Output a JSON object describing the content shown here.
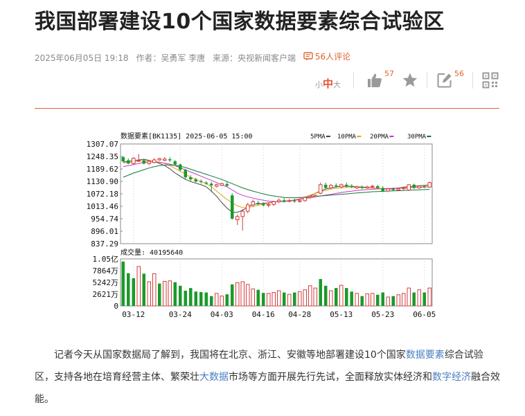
{
  "article": {
    "title": "我国部署建设10个国家数据要素综合试验区",
    "meta": {
      "datetime": "2025年06月05日 19:18",
      "author": "作者：吴勇军 李唐",
      "source": "来源：央视新闻客户端",
      "comments": "56人评论"
    },
    "body": {
      "p1": "记者今天从国家数据局了解到，我国将在北京、浙江、安徽等地部署建设10个国家",
      "link1": "数据要素",
      "p2": "综合试验区，支持各地在培育经营主体、繁荣壮",
      "link2": "大数据",
      "p3": "市场等方面开展先行先试，全面释放实体经济和",
      "link3": "数字经济",
      "p4": "融合效能。"
    }
  },
  "toolbar": {
    "font_small": "小",
    "font_mid": "中",
    "font_large": "大",
    "like_count": "57",
    "comment_count": "56",
    "icons": [
      "like-icon",
      "favorite-star-icon",
      "edit-comment-icon",
      "qrcode-icon"
    ],
    "accent_color": "#e0642d"
  },
  "chart_data": {
    "type": "candlestick",
    "header": {
      "name": "数据要素[BK1135] 2025-06-05 15:00",
      "ma_labels": [
        "5PMA-",
        "10PMA-",
        "20PMA-",
        "30PMA-"
      ],
      "ma_colors": [
        "#aaaaaa",
        "#444444",
        "#e8a317",
        "#cc33cc",
        "#117733"
      ]
    },
    "price_ticks": [
      "1307.07",
      "1248.35",
      "1189.62",
      "1130.90",
      "1072.18",
      "1013.46",
      "954.74",
      "896.01",
      "837.29"
    ],
    "price_range": [
      837.29,
      1307.07
    ],
    "volume_header": "成交量: 40195640",
    "volume_ticks": [
      "1.05亿",
      "7864万",
      "5242万",
      "2621万",
      "0"
    ],
    "volume_range": [
      0,
      105000000
    ],
    "date_ticks": [
      "03-12",
      "03-24",
      "04-03",
      "04-16",
      "04-28",
      "05-13",
      "05-23",
      "06-05"
    ],
    "date_tick_index": [
      2,
      11,
      19,
      27,
      34,
      42,
      50,
      58
    ],
    "up_color": "#d43c3c",
    "down_color": "#1a9a2a",
    "candles": [
      [
        1245,
        1250,
        1225,
        1222,
        "down"
      ],
      [
        1230,
        1240,
        1215,
        1212,
        "down"
      ],
      [
        1215,
        1245,
        1240,
        1210,
        "up"
      ],
      [
        1228,
        1260,
        1230,
        1222,
        "up"
      ],
      [
        1230,
        1238,
        1215,
        1210,
        "down"
      ],
      [
        1215,
        1232,
        1225,
        1208,
        "up"
      ],
      [
        1220,
        1240,
        1232,
        1215,
        "up"
      ],
      [
        1232,
        1242,
        1238,
        1228,
        "up"
      ],
      [
        1230,
        1245,
        1236,
        1226,
        "up"
      ],
      [
        1235,
        1245,
        1230,
        1222,
        "down"
      ],
      [
        1225,
        1232,
        1210,
        1205,
        "down"
      ],
      [
        1210,
        1215,
        1185,
        1178,
        "down"
      ],
      [
        1185,
        1190,
        1150,
        1140,
        "down"
      ],
      [
        1150,
        1160,
        1140,
        1132,
        "down"
      ],
      [
        1140,
        1148,
        1130,
        1125,
        "down"
      ],
      [
        1132,
        1140,
        1128,
        1120,
        "down"
      ],
      [
        1125,
        1132,
        1120,
        1115,
        "down"
      ],
      [
        1120,
        1128,
        1112,
        1080,
        "down"
      ],
      [
        1108,
        1120,
        1115,
        1102,
        "up"
      ],
      [
        1112,
        1125,
        1120,
        1108,
        "up"
      ],
      [
        1118,
        1128,
        1110,
        1105,
        "down"
      ],
      [
        1065,
        1075,
        955,
        950,
        "down"
      ],
      [
        950,
        975,
        965,
        925,
        "up"
      ],
      [
        965,
        1000,
        990,
        898,
        "up"
      ],
      [
        990,
        1030,
        1020,
        980,
        "up"
      ],
      [
        1020,
        1045,
        1035,
        1010,
        "up"
      ],
      [
        1030,
        1040,
        1025,
        1018,
        "down"
      ],
      [
        1025,
        1032,
        1018,
        1012,
        "down"
      ],
      [
        1018,
        1030,
        1022,
        1008,
        "up"
      ],
      [
        1022,
        1040,
        1035,
        1015,
        "up"
      ],
      [
        1035,
        1050,
        1042,
        1028,
        "up"
      ],
      [
        1042,
        1055,
        1035,
        1030,
        "down"
      ],
      [
        1038,
        1048,
        1040,
        1032,
        "up"
      ],
      [
        1040,
        1050,
        1036,
        1030,
        "down"
      ],
      [
        1036,
        1045,
        1040,
        1030,
        "up"
      ],
      [
        1040,
        1058,
        1055,
        1035,
        "up"
      ],
      [
        1055,
        1065,
        1060,
        1048,
        "up"
      ],
      [
        1060,
        1070,
        1065,
        1055,
        "up"
      ],
      [
        1075,
        1125,
        1115,
        1070,
        "up"
      ],
      [
        1115,
        1125,
        1100,
        1095,
        "down"
      ],
      [
        1100,
        1118,
        1112,
        1095,
        "up"
      ],
      [
        1112,
        1122,
        1108,
        1100,
        "down"
      ],
      [
        1105,
        1120,
        1115,
        1100,
        "up"
      ],
      [
        1115,
        1125,
        1110,
        1102,
        "down"
      ],
      [
        1110,
        1118,
        1105,
        1098,
        "down"
      ],
      [
        1100,
        1110,
        1106,
        1095,
        "up"
      ],
      [
        1106,
        1112,
        1100,
        1094,
        "down"
      ],
      [
        1100,
        1110,
        1105,
        1096,
        "up"
      ],
      [
        1105,
        1115,
        1108,
        1100,
        "up"
      ],
      [
        1108,
        1114,
        1100,
        1095,
        "down"
      ],
      [
        1100,
        1108,
        1085,
        1080,
        "down"
      ],
      [
        1085,
        1098,
        1095,
        1080,
        "up"
      ],
      [
        1095,
        1102,
        1090,
        1085,
        "down"
      ],
      [
        1090,
        1100,
        1096,
        1085,
        "up"
      ],
      [
        1096,
        1105,
        1100,
        1090,
        "up"
      ],
      [
        1090,
        1118,
        1115,
        1085,
        "up"
      ],
      [
        1115,
        1120,
        1100,
        1095,
        "down"
      ],
      [
        1100,
        1112,
        1108,
        1096,
        "up"
      ],
      [
        1108,
        1114,
        1104,
        1100,
        "down"
      ],
      [
        1104,
        1130,
        1125,
        1100,
        "up"
      ]
    ],
    "volumes": [
      [
        99,
        "down"
      ],
      [
        73,
        "down"
      ],
      [
        62,
        "down"
      ],
      [
        88,
        "up"
      ],
      [
        72,
        "down"
      ],
      [
        54,
        "up"
      ],
      [
        72,
        "up"
      ],
      [
        50,
        "down"
      ],
      [
        55,
        "up"
      ],
      [
        56,
        "up"
      ],
      [
        53,
        "down"
      ],
      [
        45,
        "down"
      ],
      [
        34,
        "down"
      ],
      [
        40,
        "down"
      ],
      [
        32,
        "down"
      ],
      [
        31,
        "down"
      ],
      [
        30,
        "down"
      ],
      [
        22,
        "down"
      ],
      [
        28,
        "up"
      ],
      [
        22,
        "up"
      ],
      [
        26,
        "down"
      ],
      [
        48,
        "down"
      ],
      [
        52,
        "up"
      ],
      [
        54,
        "up"
      ],
      [
        48,
        "up"
      ],
      [
        38,
        "up"
      ],
      [
        36,
        "down"
      ],
      [
        29,
        "down"
      ],
      [
        28,
        "up"
      ],
      [
        30,
        "up"
      ],
      [
        34,
        "up"
      ],
      [
        30,
        "down"
      ],
      [
        26,
        "up"
      ],
      [
        30,
        "down"
      ],
      [
        32,
        "up"
      ],
      [
        36,
        "up"
      ],
      [
        45,
        "up"
      ],
      [
        40,
        "up"
      ],
      [
        60,
        "down"
      ],
      [
        45,
        "down"
      ],
      [
        34,
        "up"
      ],
      [
        40,
        "down"
      ],
      [
        46,
        "up"
      ],
      [
        40,
        "down"
      ],
      [
        32,
        "down"
      ],
      [
        28,
        "up"
      ],
      [
        22,
        "down"
      ],
      [
        27,
        "up"
      ],
      [
        28,
        "up"
      ],
      [
        25,
        "down"
      ],
      [
        30,
        "down"
      ],
      [
        20,
        "up"
      ],
      [
        22,
        "down"
      ],
      [
        25,
        "up"
      ],
      [
        28,
        "up"
      ],
      [
        40,
        "up"
      ],
      [
        30,
        "down"
      ],
      [
        36,
        "up"
      ],
      [
        30,
        "down"
      ],
      [
        40,
        "up"
      ]
    ],
    "ma": {
      "ma5": [
        1222,
        1225,
        1228,
        1232,
        1235,
        1230,
        1225,
        1215,
        1205,
        1190,
        1170,
        1155,
        1140,
        1130,
        1122,
        1115,
        1105,
        1085,
        1060,
        1030,
        1005,
        985,
        985,
        995,
        1010,
        1022,
        1025,
        1027,
        1030,
        1034,
        1036,
        1038,
        1040,
        1042,
        1046,
        1052,
        1060,
        1075,
        1085,
        1095,
        1100,
        1105,
        1107,
        1108,
        1107,
        1105,
        1104,
        1102,
        1100,
        1098,
        1096,
        1095,
        1096,
        1100,
        1104,
        1106,
        1108,
        1110,
        1112,
        1115
      ],
      "ma10": [
        1218,
        1220,
        1222,
        1226,
        1228,
        1228,
        1226,
        1222,
        1215,
        1205,
        1192,
        1178,
        1165,
        1150,
        1140,
        1130,
        1120,
        1105,
        1085,
        1065,
        1045,
        1030,
        1015,
        1008,
        1008,
        1012,
        1018,
        1024,
        1028,
        1032,
        1035,
        1038,
        1040,
        1044,
        1050,
        1058,
        1066,
        1074,
        1082,
        1088,
        1094,
        1098,
        1100,
        1102,
        1102,
        1102,
        1101,
        1100,
        1099,
        1098,
        1097,
        1097,
        1098,
        1100,
        1102,
        1104,
        1106,
        1108,
        1110,
        1112
      ],
      "ma20": [
        1200,
        1205,
        1210,
        1215,
        1220,
        1222,
        1222,
        1220,
        1217,
        1212,
        1205,
        1195,
        1185,
        1175,
        1165,
        1155,
        1145,
        1135,
        1125,
        1115,
        1105,
        1090,
        1075,
        1065,
        1058,
        1052,
        1046,
        1042,
        1038,
        1036,
        1035,
        1036,
        1038,
        1042,
        1046,
        1050,
        1054,
        1058,
        1062,
        1066,
        1070,
        1074,
        1078,
        1082,
        1085,
        1088,
        1090,
        1092,
        1094,
        1095,
        1096,
        1097,
        1098,
        1099,
        1100,
        1101,
        1102,
        1103,
        1104,
        1105
      ],
      "ma30": [
        1150,
        1160,
        1170,
        1178,
        1186,
        1194,
        1200,
        1205,
        1208,
        1208,
        1206,
        1202,
        1196,
        1188,
        1180,
        1172,
        1164,
        1156,
        1148,
        1140,
        1130,
        1120,
        1110,
        1100,
        1092,
        1085,
        1078,
        1072,
        1066,
        1062,
        1058,
        1055,
        1054,
        1054,
        1055,
        1056,
        1058,
        1060,
        1062,
        1064,
        1066,
        1068,
        1070,
        1072,
        1074,
        1076,
        1078,
        1080,
        1082,
        1083,
        1084,
        1085,
        1086,
        1087,
        1088,
        1089,
        1090,
        1091,
        1092,
        1093
      ]
    }
  }
}
